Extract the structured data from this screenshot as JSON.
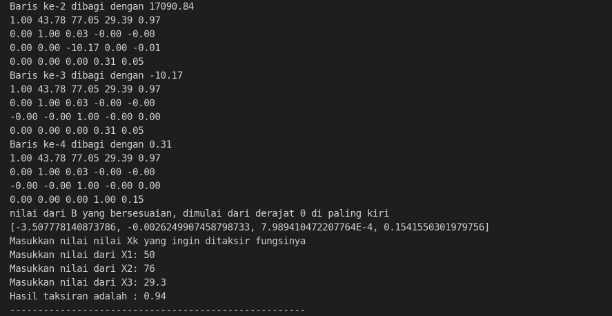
{
  "terminal": {
    "lines": [
      "Baris ke-2 dibagi dengan 17090.84",
      "1.00 43.78 77.05 29.39 0.97",
      "0.00 1.00 0.03 -0.00 -0.00",
      "0.00 0.00 -10.17 0.00 -0.01",
      "0.00 0.00 0.00 0.31 0.05",
      "Baris ke-3 dibagi dengan -10.17",
      "1.00 43.78 77.05 29.39 0.97",
      "0.00 1.00 0.03 -0.00 -0.00",
      "-0.00 -0.00 1.00 -0.00 0.00",
      "0.00 0.00 0.00 0.31 0.05",
      "Baris ke-4 dibagi dengan 0.31",
      "1.00 43.78 77.05 29.39 0.97",
      "0.00 1.00 0.03 -0.00 -0.00",
      "-0.00 -0.00 1.00 -0.00 0.00",
      "0.00 0.00 0.00 1.00 0.15",
      "nilai dari B yang bersesuaian, dimulai dari derajat 0 di paling kiri",
      "[-3.507778140873786, -0.0026249907458798733, 7.989410472207764E-4, 0.1541550301979756]",
      "Masukkan nilai nilai Xk yang ingin ditaksir fungsinya",
      "Masukkan nilai dari X1: 50",
      "Masukkan nilai dari X2: 76",
      "Masukkan nilai dari X3: 29.3",
      "Hasil taksiran adalah : 0.94",
      "-----------------------------------------------------"
    ]
  },
  "colors": {
    "background": "#1e1e1e",
    "text": "#cccccc"
  }
}
